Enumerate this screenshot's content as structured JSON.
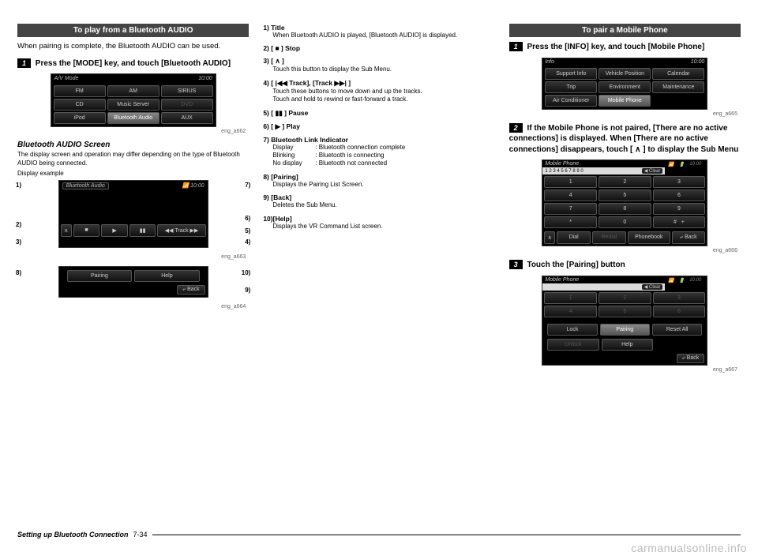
{
  "footer": {
    "section": "Setting up Bluetooth Connection",
    "page": "7-34"
  },
  "watermark": "carmanualsonline.info",
  "col1": {
    "title": "To play from a Bluetooth AUDIO",
    "intro": "When pairing is complete, the Bluetooth AUDIO can be used.",
    "step_badge": "1",
    "step": " Press the [MODE] key, and touch [Bluetooth AUDIO]",
    "screen": {
      "title": "A/V Mode",
      "clock": "10:00",
      "btns": [
        "FM",
        "AM",
        "SIRIUS",
        "CD",
        "Music Server",
        "DVD",
        "iPod",
        "Bluetooth Audio",
        "AUX"
      ],
      "ref": "eng_a662"
    },
    "sub_h": "Bluetooth AUDIO Screen",
    "sub_p": "The display screen and operation may differ depending on the type of Bluetooth AUDIO being connected.",
    "disp_ex": "Display example",
    "annot": {
      "left": [
        "1)",
        "2)",
        "3)",
        "8)"
      ],
      "right": [
        "7)",
        "6)",
        "5)",
        "4)",
        "10)",
        "9)"
      ]
    },
    "a663": {
      "title": "Bluetooth Audio",
      "track": "Track",
      "ref": "eng_a663"
    },
    "a664": {
      "pairing": "Pairing",
      "help": "Help",
      "back": "Back",
      "ref": "eng_a664"
    }
  },
  "col2": {
    "items": [
      {
        "lbl": "1)  Title",
        "desc": [
          "When Bluetooth AUDIO is played, [Bluetooth AUDIO] is displayed."
        ]
      },
      {
        "lbl": "2)  [ ■ ] Stop",
        "desc": []
      },
      {
        "lbl": "3)  [ ∧ ]",
        "desc": [
          "Touch this button to display the Sub Menu."
        ]
      },
      {
        "lbl": "4)  [ |◀◀ Track], [Track ▶▶| ]",
        "desc": [
          "Touch these buttons to move down and up the tracks.",
          "Touch and hold to rewind or fast-forward a track."
        ]
      },
      {
        "lbl": "5)  [ ▮▮ ] Pause",
        "desc": []
      },
      {
        "lbl": "6)  [ ▶ ] Play",
        "desc": []
      },
      {
        "lbl": "7)  Bluetooth Link Indicator",
        "desc": [],
        "rows": [
          {
            "k": "Display",
            "v": ": Bluetooth connection complete"
          },
          {
            "k": "Blinking",
            "v": ": Bluetooth is connecting"
          },
          {
            "k": "No display",
            "v": ": Bluetooth not connected"
          }
        ]
      },
      {
        "lbl": "8)  [Pairing]",
        "desc": [
          "Displays the Pairing List Screen."
        ]
      },
      {
        "lbl": "9)  [Back]",
        "desc": [
          "Deletes the Sub Menu."
        ]
      },
      {
        "lbl": "10)[Help]",
        "desc": [
          "Displays the VR Command List screen."
        ]
      }
    ]
  },
  "col3": {
    "title": "To pair a Mobile Phone",
    "step1_badge": "1",
    "step1": " Press the [INFO] key, and touch [Mobile Phone]",
    "info_screen": {
      "title": "Info",
      "clock": "10:00",
      "btns": [
        "Support Info",
        "Vehicle Position",
        "Calendar",
        "Trip",
        "Environment",
        "Maintenance",
        "Air Conditioner",
        "Mobile Phone"
      ],
      "ref": "eng_a665"
    },
    "step2_badge": "2",
    "step2": " If the Mobile Phone is not paired, [There are no active connections] is displayed. When [There are no active connections] disappears, touch [ ∧ ] to display the Sub Menu",
    "phone_screen": {
      "title": "Mobile Phone",
      "clock": "10:00",
      "nums": "1 2 3 4 5 6 7 8 9 0",
      "clear": "◀ Clear",
      "pad": [
        "1",
        "2",
        "3",
        "4",
        "5",
        "6",
        "7",
        "8",
        "9",
        "*",
        "0",
        "#",
        "+"
      ],
      "bar": [
        "∧",
        "Dial",
        "Redial",
        "Phonebook",
        "Back"
      ],
      "ref": "eng_a666"
    },
    "step3_badge": "3",
    "step3": " Touch the [Pairing] button",
    "pair_screen": {
      "title": "Mobile Phone",
      "clock": "10:00",
      "clear": "◀ Clear",
      "btns_top": [
        "Lock",
        "Pairing",
        "Reset All"
      ],
      "btns_bot": [
        "Unlock",
        "Help"
      ],
      "back": "Back",
      "ref": "eng_a667"
    }
  }
}
